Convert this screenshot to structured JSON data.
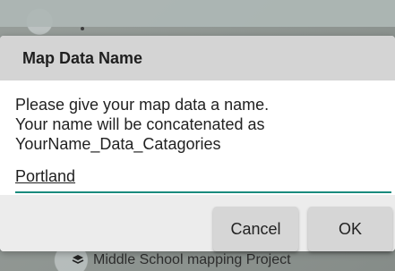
{
  "background": {
    "bottom_label": "Middle School mapping Project",
    "layers_icon": "layers-icon"
  },
  "dialog": {
    "title": "Map Data Name",
    "message": {
      "line1": "Please give your map data a name.",
      "line2": "Your name will be concatenated as",
      "line3": "YourName_Data_Catagories"
    },
    "input": {
      "value": "Portland",
      "placeholder": ""
    },
    "buttons": {
      "cancel": "Cancel",
      "ok": "OK"
    }
  },
  "colors": {
    "accent": "#1a8b7d",
    "dialog_header": "#d4d4d4",
    "dialog_body": "#ffffff",
    "button_bg": "#d6d6d6",
    "overlay_bg": "#8e9591"
  }
}
